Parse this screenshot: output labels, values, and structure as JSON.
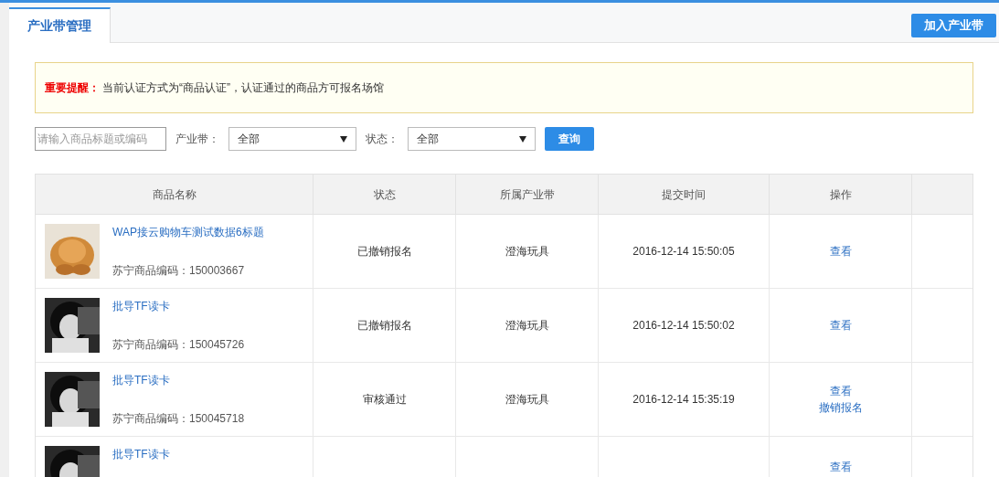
{
  "tabs": [
    {
      "label": "产业带管理",
      "selected": true
    }
  ],
  "add_button": "加入产业带",
  "notice": {
    "label": "重要提醒：",
    "text": "当前认证方式为“商品认证”，认证通过的商品方可报名场馆"
  },
  "filters": {
    "search": {
      "placeholder": "请输入商品标题或编码"
    },
    "industry": {
      "label": "产业带：",
      "value": "全部"
    },
    "status": {
      "label": "状态：",
      "value": "全部"
    },
    "query_button": "查询"
  },
  "table": {
    "columns": [
      "商品名称",
      "状态",
      "所属产业带",
      "提交时间",
      "操作"
    ],
    "rows": [
      {
        "title": "WAP接云购物车测试数据6标题",
        "code": "苏宁商品编码：150003667",
        "status": "已撤销报名",
        "industry": "澄海玩具",
        "time": "2016-12-14 15:50:05",
        "actions": [
          "查看"
        ]
      },
      {
        "title": "批导TF读卡",
        "code": "苏宁商品编码：150045726",
        "status": "已撤销报名",
        "industry": "澄海玩具",
        "time": "2016-12-14 15:50:02",
        "actions": [
          "查看"
        ]
      },
      {
        "title": "批导TF读卡",
        "code": "苏宁商品编码：150045718",
        "status": "审核通过",
        "industry": "澄海玩具",
        "time": "2016-12-14 15:35:19",
        "actions": [
          "查看",
          "撤销报名"
        ]
      },
      {
        "title": "批导TF读卡",
        "actions": [
          "查看"
        ]
      }
    ]
  }
}
